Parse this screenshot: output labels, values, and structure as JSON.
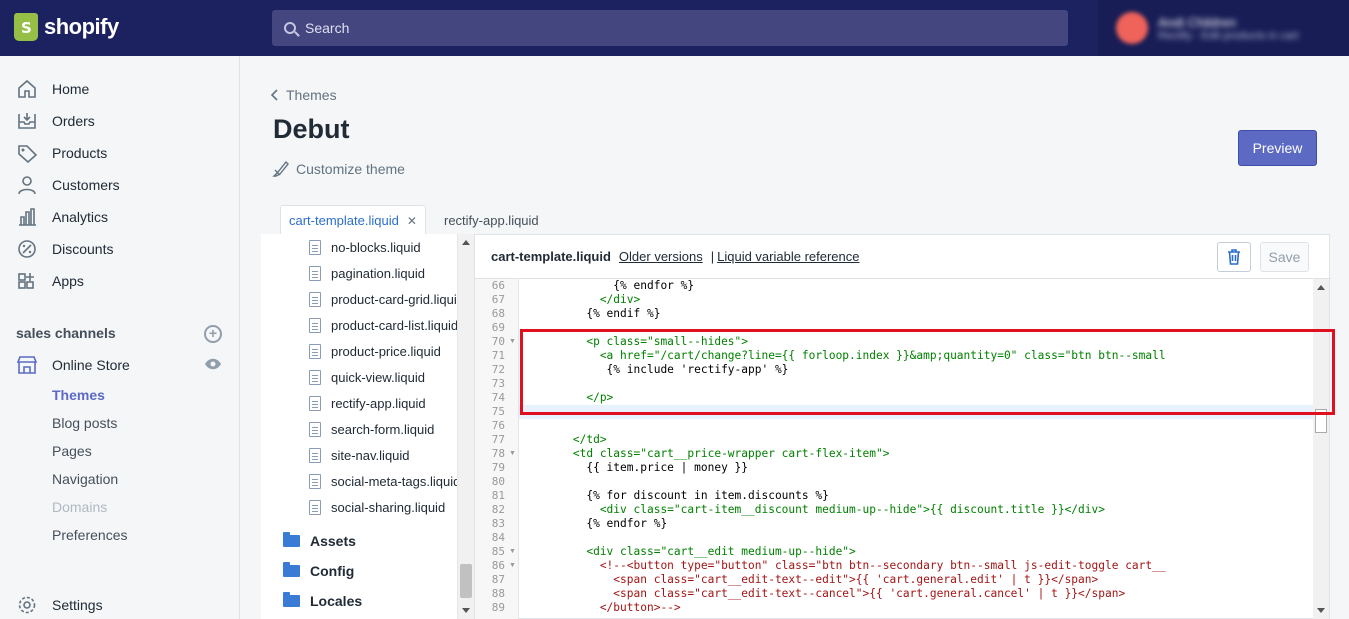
{
  "topbar": {
    "logo_text": "shopify",
    "search_placeholder": "Search",
    "account_name": "Andi Children",
    "account_sub": "Rectify - Edit products in cart"
  },
  "sidebar": {
    "items": [
      {
        "label": "Home",
        "icon": "home-icon"
      },
      {
        "label": "Orders",
        "icon": "orders-icon"
      },
      {
        "label": "Products",
        "icon": "tag-icon"
      },
      {
        "label": "Customers",
        "icon": "person-icon"
      },
      {
        "label": "Analytics",
        "icon": "bar-chart-icon"
      },
      {
        "label": "Discounts",
        "icon": "discount-icon"
      },
      {
        "label": "Apps",
        "icon": "apps-icon"
      }
    ],
    "sales_channels_title": "sales channels",
    "online_store": "Online Store",
    "sub_items": [
      "Themes",
      "Blog posts",
      "Pages",
      "Navigation",
      "Domains",
      "Preferences"
    ],
    "settings": "Settings"
  },
  "header": {
    "breadcrumb": "Themes",
    "title": "Debut",
    "customize": "Customize theme",
    "preview": "Preview"
  },
  "tabs": [
    {
      "label": "cart-template.liquid",
      "active": true
    },
    {
      "label": "rectify-app.liquid",
      "active": false
    }
  ],
  "tree": {
    "files": [
      "no-blocks.liquid",
      "pagination.liquid",
      "product-card-grid.liquid",
      "product-card-list.liquid",
      "product-price.liquid",
      "quick-view.liquid",
      "rectify-app.liquid",
      "search-form.liquid",
      "site-nav.liquid",
      "social-meta-tags.liquid",
      "social-sharing.liquid"
    ],
    "folders": [
      "Assets",
      "Config",
      "Locales"
    ]
  },
  "editor": {
    "filename": "cart-template.liquid",
    "older_versions": "Older versions",
    "separator": "|",
    "liquid_ref": "Liquid variable reference",
    "save": "Save",
    "line_numbers": [
      "66",
      "67",
      "68",
      "69",
      "70",
      "71",
      "72",
      "73",
      "74",
      "75",
      "76",
      "77",
      "78",
      "79",
      "80",
      "81",
      "82",
      "83",
      "84",
      "85",
      "86",
      "87",
      "88",
      "89"
    ],
    "fold_lines": [
      "70",
      "78",
      "85",
      "86"
    ],
    "lines": [
      "              {% endfor %}",
      "            </div>",
      "          {% endif %}",
      "",
      "          <p class=\"small--hides\">",
      "            <a href=\"/cart/change?line={{ forloop.index }}&amp;quantity=0\" class=\"btn btn--small",
      "             {% include 'rectify-app' %}",
      "",
      "          </p>",
      "",
      "",
      "        </td>",
      "        <td class=\"cart__price-wrapper cart-flex-item\">",
      "          {{ item.price | money }}",
      "",
      "          {% for discount in item.discounts %}",
      "            <div class=\"cart-item__discount medium-up--hide\">{{ discount.title }}</div>",
      "          {% endfor %}",
      "",
      "          <div class=\"cart__edit medium-up--hide\">",
      "            <!--<button type=\"button\" class=\"btn btn--secondary btn--small js-edit-toggle cart__",
      "              <span class=\"cart__edit-text--edit\">{{ 'cart.general.edit' | t }}</span>",
      "              <span class=\"cart__edit-text--cancel\">{{ 'cart.general.cancel' | t }}</span>",
      "            </button>-->"
    ]
  }
}
